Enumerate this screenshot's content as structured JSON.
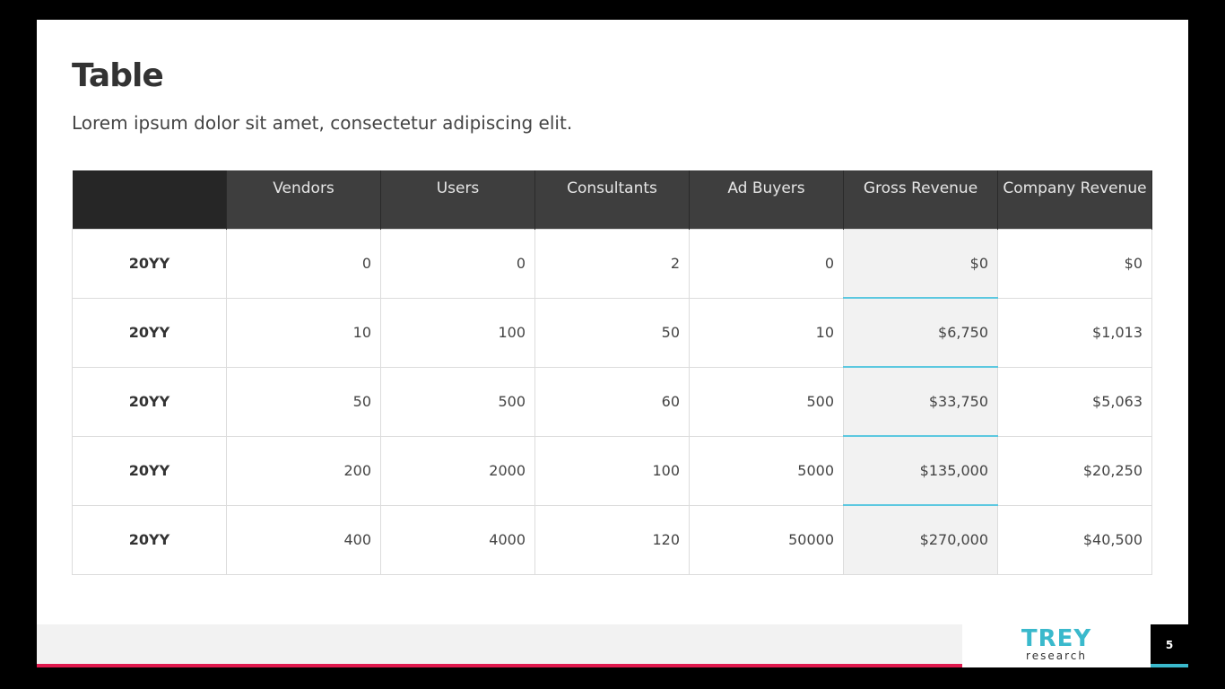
{
  "slide": {
    "title": "Table",
    "subtitle": "Lorem ipsum dolor sit amet, consectetur adipiscing elit.",
    "page_number": "5"
  },
  "logo": {
    "word": "TREY",
    "sub": "research"
  },
  "table": {
    "headers": [
      "",
      "Vendors",
      "Users",
      "Consultants",
      "Ad Buyers",
      "Gross Revenue",
      "Company Revenue"
    ],
    "rows": [
      [
        "20YY",
        "0",
        "0",
        "2",
        "0",
        "$0",
        "$0"
      ],
      [
        "20YY",
        "10",
        "100",
        "50",
        "10",
        "$6,750",
        "$1,013"
      ],
      [
        "20YY",
        "50",
        "500",
        "60",
        "500",
        "$33,750",
        "$5,063"
      ],
      [
        "20YY",
        "200",
        "2000",
        "100",
        "5000",
        "$135,000",
        "$20,250"
      ],
      [
        "20YY",
        "400",
        "4000",
        "120",
        "50000",
        "$270,000",
        "$40,500"
      ]
    ]
  },
  "colors": {
    "header_bg": "#3e3e3e",
    "corner_bg": "#262626",
    "highlight_col_bg": "#f2f2f2",
    "teal_accent": "#3ab9cc",
    "pink_accent": "#e0194e"
  }
}
